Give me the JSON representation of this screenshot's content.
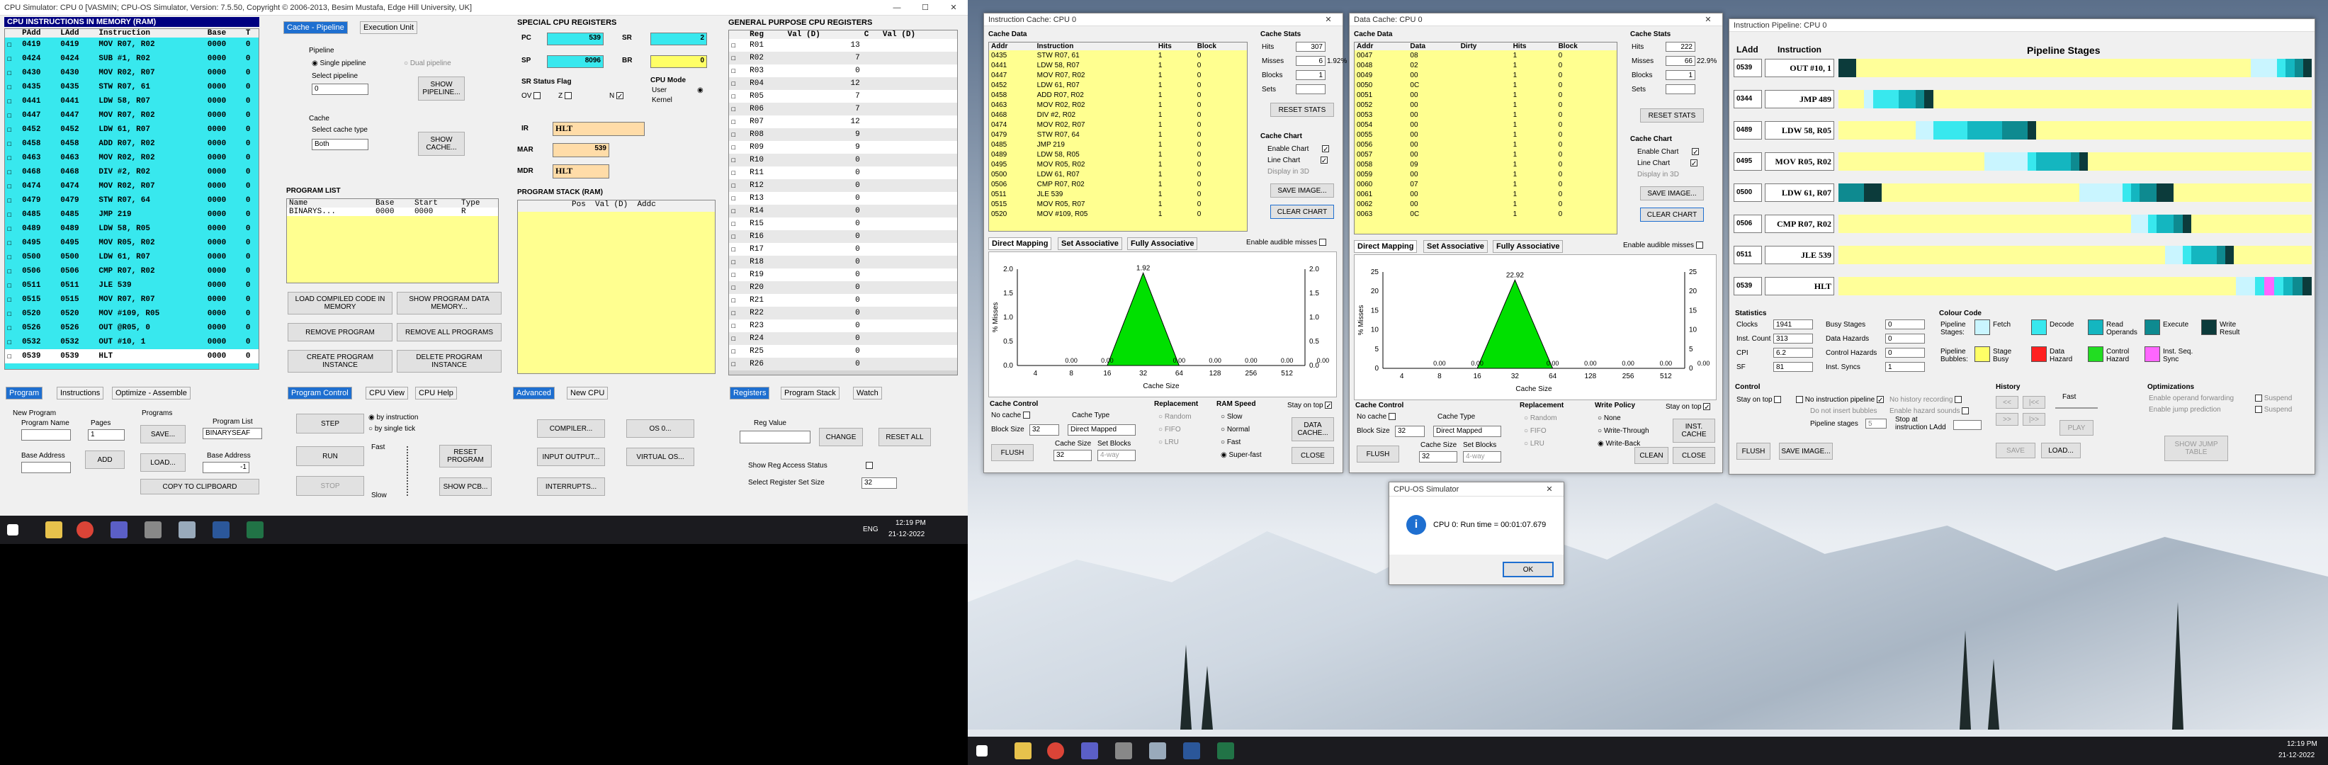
{
  "cpu": {
    "title": "CPU Simulator: CPU 0    [VASMIN; CPU-OS Simulator,  Version: 7.5.50,  Copyright © 2006-2013, Besim Mustafa, Edge Hill University, UK]",
    "instr_header": "CPU INSTRUCTIONS IN MEMORY (RAM)",
    "instr_cols": [
      "PAdd",
      "LAdd",
      "Instruction",
      "Base",
      "T"
    ],
    "instructions": [
      [
        "0419",
        "0419",
        "MOV R07, R02",
        "0000",
        "0"
      ],
      [
        "0424",
        "0424",
        "SUB #1, R02",
        "0000",
        "0"
      ],
      [
        "0430",
        "0430",
        "MOV R02, R07",
        "0000",
        "0"
      ],
      [
        "0435",
        "0435",
        "STW R07, 61",
        "0000",
        "0"
      ],
      [
        "0441",
        "0441",
        "LDW 58, R07",
        "0000",
        "0"
      ],
      [
        "0447",
        "0447",
        "MOV R07, R02",
        "0000",
        "0"
      ],
      [
        "0452",
        "0452",
        "LDW 61, R07",
        "0000",
        "0"
      ],
      [
        "0458",
        "0458",
        "ADD R07, R02",
        "0000",
        "0"
      ],
      [
        "0463",
        "0463",
        "MOV R02, R02",
        "0000",
        "0"
      ],
      [
        "0468",
        "0468",
        "DIV #2, R02",
        "0000",
        "0"
      ],
      [
        "0474",
        "0474",
        "MOV R02, R07",
        "0000",
        "0"
      ],
      [
        "0479",
        "0479",
        "STW R07, 64",
        "0000",
        "0"
      ],
      [
        "0485",
        "0485",
        "JMP 219",
        "0000",
        "0"
      ],
      [
        "0489",
        "0489",
        "LDW 58, R05",
        "0000",
        "0"
      ],
      [
        "0495",
        "0495",
        "MOV R05, R02",
        "0000",
        "0"
      ],
      [
        "0500",
        "0500",
        "LDW 61, R07",
        "0000",
        "0"
      ],
      [
        "0506",
        "0506",
        "CMP R07, R02",
        "0000",
        "0"
      ],
      [
        "0511",
        "0511",
        "JLE 539",
        "0000",
        "0"
      ],
      [
        "0515",
        "0515",
        "MOV R07, R07",
        "0000",
        "0"
      ],
      [
        "0520",
        "0520",
        "MOV #109, R05",
        "0000",
        "0"
      ],
      [
        "0526",
        "0526",
        "OUT @R05, 0",
        "0000",
        "0"
      ],
      [
        "0532",
        "0532",
        "OUT #10, 1",
        "0000",
        "0"
      ],
      [
        "0539",
        "0539",
        "HLT",
        "0000",
        "0"
      ]
    ],
    "tabs_left": [
      "Program",
      "Instructions",
      "Optimize - Assemble"
    ],
    "new_program_label": "New Program",
    "program_name_label": "Program Name",
    "pages_label": "Pages",
    "pages_value": "1",
    "programs_label": "Programs",
    "save_label": "SAVE...",
    "program_list_label": "Program List",
    "program_list_value": "BINARYSEAF",
    "base_address_label": "Base Address",
    "add_label": "ADD",
    "load_label": "LOAD...",
    "base_address2_label": "Base Address",
    "base_address2_value": "-1",
    "copy_label": "COPY TO CLIPBOARD",
    "cache_tabs": [
      "Cache - Pipeline",
      "Execution Unit"
    ],
    "pipeline_label": "Pipeline",
    "single_pipeline": "Single pipeline",
    "dual_pipeline": "Dual pipeline",
    "select_pipeline": "Select pipeline",
    "select_pipeline_value": "0",
    "show_pipeline": "SHOW PIPELINE...",
    "cache_label": "Cache",
    "select_cache_type": "Select cache type",
    "cache_type_value": "Both",
    "show_cache": "SHOW CACHE...",
    "program_list_header": "PROGRAM LIST",
    "program_list_cols": [
      "Name",
      "Base",
      "Start",
      "Type"
    ],
    "program_list_row": [
      "BINARYS...",
      "0000",
      "0000",
      "R"
    ],
    "load_compiled": "LOAD COMPILED CODE IN MEMORY",
    "show_program_data": "SHOW PROGRAM DATA MEMORY...",
    "remove_program": "REMOVE PROGRAM",
    "remove_all_programs": "REMOVE ALL PROGRAMS",
    "create_instance": "CREATE PROGRAM INSTANCE",
    "delete_instance": "DELETE PROGRAM INSTANCE",
    "control_tabs": [
      "Program Control",
      "CPU View",
      "CPU Help"
    ],
    "step": "STEP",
    "by_instruction": "by instruction",
    "by_tick": "by single tick",
    "run": "RUN",
    "reset_program": "RESET PROGRAM",
    "stop": "STOP",
    "show_pcb": "SHOW PCB...",
    "fast": "Fast",
    "slow": "Slow",
    "advanced_tabs": [
      "Advanced",
      "New CPU"
    ],
    "compiler": "COMPILER...",
    "os": "OS 0...",
    "input_output": "INPUT OUTPUT...",
    "virtual_os": "VIRTUAL OS...",
    "interrupts": "INTERRUPTS...",
    "special_header": "SPECIAL CPU REGISTERS",
    "pc_label": "PC",
    "pc": "539",
    "sr_label": "SR",
    "sr": "2",
    "sp_label": "SP",
    "sp": "8096",
    "br_label": "BR",
    "br": "0",
    "flags_label": "SR Status Flag",
    "flags": [
      "OV",
      "Z",
      "N"
    ],
    "cpu_mode": "CPU Mode",
    "user_label": "User",
    "kernel_label": "Kernel",
    "ir_label": "IR",
    "ir": "HLT",
    "mar_label": "MAR",
    "mar": "539",
    "mdr_label": "MDR",
    "mdr": "HLT",
    "stack_header": "PROGRAM STACK (RAM)",
    "stack_cols": [
      "Pos",
      "Val (D)",
      "Addc"
    ],
    "gp_header": "GENERAL PURPOSE CPU REGISTERS",
    "gp_cols": [
      "Reg",
      "Val (D)",
      "C",
      "Val (D)"
    ],
    "registers": [
      [
        "R01",
        "13"
      ],
      [
        "R02",
        "7"
      ],
      [
        "R03",
        "0"
      ],
      [
        "R04",
        "12"
      ],
      [
        "R05",
        "7"
      ],
      [
        "R06",
        "7"
      ],
      [
        "R07",
        "12"
      ],
      [
        "R08",
        "9"
      ],
      [
        "R09",
        "9"
      ],
      [
        "R10",
        "0"
      ],
      [
        "R11",
        "0"
      ],
      [
        "R12",
        "0"
      ],
      [
        "R13",
        "0"
      ],
      [
        "R14",
        "0"
      ],
      [
        "R15",
        "0"
      ],
      [
        "R16",
        "0"
      ],
      [
        "R17",
        "0"
      ],
      [
        "R18",
        "0"
      ],
      [
        "R19",
        "0"
      ],
      [
        "R20",
        "0"
      ],
      [
        "R21",
        "0"
      ],
      [
        "R22",
        "0"
      ],
      [
        "R23",
        "0"
      ],
      [
        "R24",
        "0"
      ],
      [
        "R25",
        "0"
      ],
      [
        "R26",
        "0"
      ]
    ],
    "reg_tabs": [
      "Registers",
      "Program Stack",
      "Watch"
    ],
    "reg_value_label": "Reg Value",
    "change": "CHANGE",
    "reset_all": "RESET ALL",
    "show_reg_access": "Show Reg Access Status",
    "select_reg_set": "Select Register Set Size",
    "reg_set_value": "32"
  },
  "icache": {
    "title": "Instruction Cache: CPU 0",
    "cache_data": "Cache Data",
    "cols": [
      "Addr",
      "Instruction",
      "Hits",
      "Block"
    ],
    "rows": [
      [
        "0435",
        "STW R07, 61",
        "1",
        "0"
      ],
      [
        "0441",
        "LDW 58, R07",
        "1",
        "0"
      ],
      [
        "0447",
        "MOV R07, R02",
        "1",
        "0"
      ],
      [
        "0452",
        "LDW 61, R07",
        "1",
        "0"
      ],
      [
        "0458",
        "ADD R07, R02",
        "1",
        "0"
      ],
      [
        "0463",
        "MOV R02, R02",
        "1",
        "0"
      ],
      [
        "0468",
        "DIV #2, R02",
        "1",
        "0"
      ],
      [
        "0474",
        "MOV R02, R07",
        "1",
        "0"
      ],
      [
        "0479",
        "STW R07, 64",
        "1",
        "0"
      ],
      [
        "0485",
        "JMP 219",
        "1",
        "0"
      ],
      [
        "0489",
        "LDW 58, R05",
        "1",
        "0"
      ],
      [
        "0495",
        "MOV R05, R02",
        "1",
        "0"
      ],
      [
        "0500",
        "LDW 61, R07",
        "1",
        "0"
      ],
      [
        "0506",
        "CMP R07, R02",
        "1",
        "0"
      ],
      [
        "0511",
        "JLE 539",
        "1",
        "0"
      ],
      [
        "0515",
        "MOV R05, R07",
        "1",
        "0"
      ],
      [
        "0520",
        "MOV #109, R05",
        "1",
        "0"
      ]
    ],
    "stats": "Cache Stats",
    "hits_label": "Hits",
    "hits": "307",
    "misses_label": "Misses",
    "misses": "6",
    "miss_pct": "1.92%",
    "blocks_label": "Blocks",
    "blocks": "1",
    "sets_label": "Sets",
    "sets": "",
    "reset_stats": "RESET STATS",
    "chart": "Cache Chart",
    "enable_chart": "Enable Chart",
    "line_chart": "Line Chart",
    "display3d": "Display in 3D",
    "save_image": "SAVE IMAGE...",
    "clear_chart": "CLEAR CHART",
    "map_tabs": [
      "Direct Mapping",
      "Set Associative",
      "Fully Associative"
    ],
    "audible": "Enable audible misses",
    "chart_peak": "1.92",
    "y_label": "% Misses",
    "x_label": "Cache Size",
    "x_ticks": [
      "4",
      "8",
      "16",
      "32",
      "64",
      "128",
      "256",
      "512"
    ],
    "y_ticks": [
      "2.0",
      "1.5",
      "1.0",
      "0.5",
      "0.0"
    ],
    "zeros": [
      "0.00",
      "0.00",
      "0.00",
      "0.00",
      "0.00",
      "0.00",
      "0.00"
    ],
    "control": "Cache Control",
    "no_cache": "No cache",
    "block_size_label": "Block Size",
    "block_size": "32",
    "cache_type_label": "Cache Type",
    "cache_type": "Direct Mapped",
    "cache_size_label": "Cache Size",
    "cache_size": "32",
    "set_blocks_label": "Set Blocks",
    "set_blocks": "4-way",
    "flush": "FLUSH",
    "replacement": "Replacement",
    "repl": [
      "Random",
      "FIFO",
      "LRU"
    ],
    "ram_speed": "RAM Speed",
    "speeds": [
      "Slow",
      "Normal",
      "Fast",
      "Super-fast"
    ],
    "stay_on_top": "Stay on top",
    "data_cache_btn": "DATA CACHE...",
    "close": "CLOSE"
  },
  "dcache": {
    "title": "Data Cache: CPU 0",
    "cache_data": "Cache Data",
    "cols": [
      "Addr",
      "Data",
      "Dirty",
      "Hits",
      "Block"
    ],
    "rows": [
      [
        "0047",
        "08",
        "",
        "1",
        "0"
      ],
      [
        "0048",
        "02",
        "",
        "1",
        "0"
      ],
      [
        "0049",
        "00",
        "",
        "1",
        "0"
      ],
      [
        "0050",
        "0C",
        "",
        "1",
        "0"
      ],
      [
        "0051",
        "00",
        "",
        "1",
        "0"
      ],
      [
        "0052",
        "00",
        "",
        "1",
        "0"
      ],
      [
        "0053",
        "00",
        "",
        "1",
        "0"
      ],
      [
        "0054",
        "00",
        "",
        "1",
        "0"
      ],
      [
        "0055",
        "00",
        "",
        "1",
        "0"
      ],
      [
        "0056",
        "00",
        "",
        "1",
        "0"
      ],
      [
        "0057",
        "00",
        "",
        "1",
        "0"
      ],
      [
        "0058",
        "09",
        "",
        "1",
        "0"
      ],
      [
        "0059",
        "00",
        "",
        "1",
        "0"
      ],
      [
        "0060",
        "07",
        "",
        "1",
        "0"
      ],
      [
        "0061",
        "00",
        "",
        "1",
        "0"
      ],
      [
        "0062",
        "00",
        "",
        "1",
        "0"
      ],
      [
        "0063",
        "0C",
        "",
        "1",
        "0"
      ]
    ],
    "stats": "Cache Stats",
    "hits": "222",
    "misses": "66",
    "miss_pct": "22.9%",
    "blocks": "1",
    "sets": "",
    "chart_peak": "22.92",
    "y_ticks": [
      "25",
      "20",
      "15",
      "10",
      "5",
      "0"
    ],
    "zeros": [
      "0.00",
      "0.00",
      "0.00",
      "0.00",
      "0.00",
      "0.00",
      "0.00"
    ],
    "write_policy": "Write Policy",
    "policies": [
      "None",
      "Write-Through",
      "Write-Back"
    ],
    "inst_cache_btn": "INST. CACHE",
    "clean": "CLEAN"
  },
  "pipeline": {
    "title": "Instruction Pipeline: CPU 0",
    "col_ladd": "LAdd",
    "col_instr": "Instruction",
    "col_stages": "Pipeline Stages",
    "rows": [
      [
        "0539",
        "OUT #10, 1"
      ],
      [
        "0344",
        "JMP 489"
      ],
      [
        "0489",
        "LDW 58, R05"
      ],
      [
        "0495",
        "MOV R05, R02"
      ],
      [
        "0500",
        "LDW 61, R07"
      ],
      [
        "0506",
        "CMP R07, R02"
      ],
      [
        "0511",
        "JLE 539"
      ],
      [
        "0539",
        "HLT"
      ]
    ],
    "statistics": "Statistics",
    "clocks_label": "Clocks",
    "clocks": "1941",
    "inst_count_label": "Inst. Count",
    "inst_count": "313",
    "cpi_label": "CPI",
    "cpi": "6.2",
    "sf_label": "SF",
    "sf": "81",
    "busy_stages_label": "Busy Stages",
    "busy_stages": "0",
    "data_hazards_label": "Data Hazards",
    "data_hazards": "0",
    "control_hazards_label": "Control Hazards",
    "control_hazards": "0",
    "inst_syncs_label": "Inst. Syncs",
    "inst_syncs": "1",
    "colour_code": "Colour Code",
    "legend": [
      {
        "label": "Fetch",
        "color": "#c9f5ff"
      },
      {
        "label": "Decode",
        "color": "#38e8ee"
      },
      {
        "label": "Read Operands",
        "color": "#14b6c0"
      },
      {
        "label": "Execute",
        "color": "#0e8a90"
      },
      {
        "label": "Write Result",
        "color": "#0c3b3b"
      },
      {
        "label": "Stage Busy",
        "color": "#ffff66"
      },
      {
        "label": "Data Hazard",
        "color": "#ff2020"
      },
      {
        "label": "Control Hazard",
        "color": "#22dd22"
      },
      {
        "label": "Inst. Seq. Sync",
        "color": "#ff66ff"
      }
    ],
    "pipeline_stages_label": "Pipeline Stages:",
    "pipeline_bubbles_label": "Pipeline Bubbles:",
    "control": "Control",
    "stay_on_top": "Stay on top",
    "no_instr_pipeline": "No instruction pipeline",
    "no_history": "No history recording",
    "no_bubbles": "Do not insert bubbles",
    "enable_hazard_sounds": "Enable hazard sounds",
    "pipeline_stages": "Pipeline stages",
    "pipeline_stages_value": "5",
    "stop_at": "Stop at instruction LAdd",
    "history": "History",
    "fast": "Fast",
    "play": "PLAY",
    "save": "SAVE",
    "load": "LOAD...",
    "optimizations": "Optimizations",
    "opt1": "Enable operand forwarding",
    "opt2": "Enable jump prediction",
    "suspend": "Suspend",
    "show_jump_table": "SHOW JUMP TABLE",
    "flush": "FLUSH",
    "save_image": "SAVE IMAGE..."
  },
  "dialog": {
    "title": "CPU-OS Simulator",
    "message": "CPU 0: Run time = 00:01:07.679",
    "ok": "OK"
  },
  "taskbar": {
    "time": "12:19 PM",
    "date": "21-12-2022",
    "lang": "ENG"
  }
}
